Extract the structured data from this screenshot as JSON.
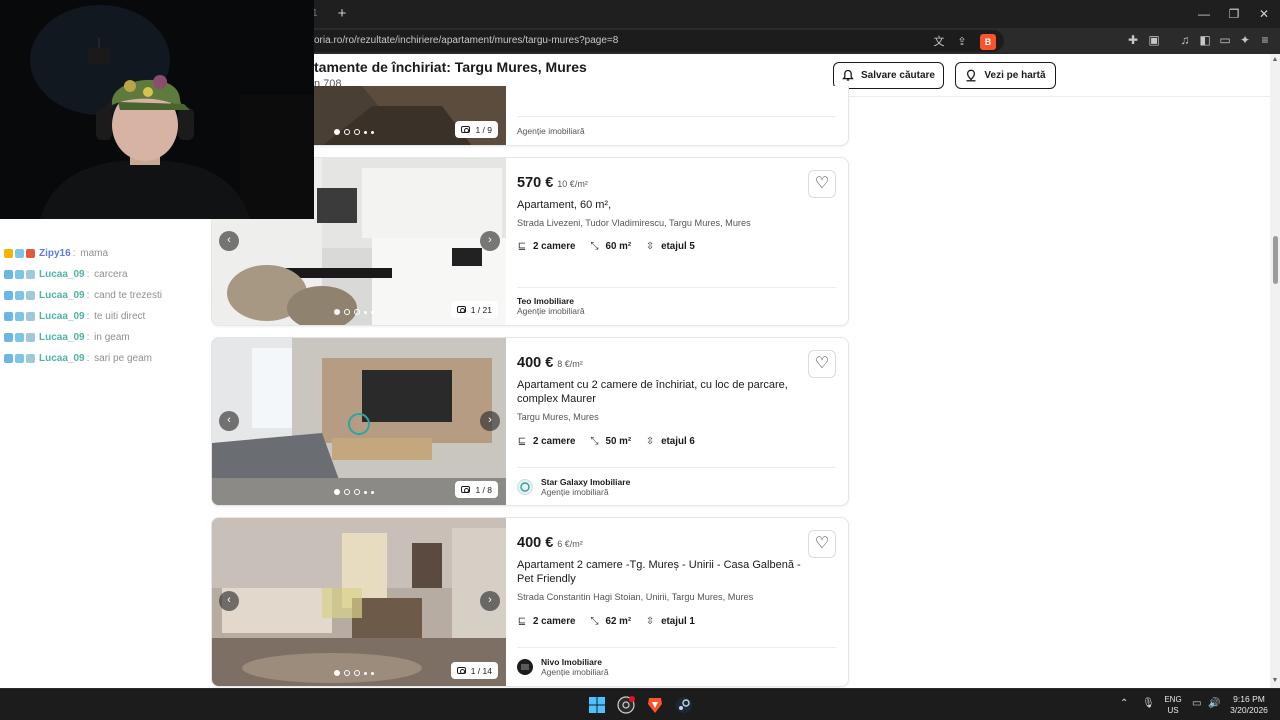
{
  "browser": {
    "url": "oria.ro/ro/rezultate/inchiriere/apartament/mures/targu-mures?page=8",
    "new_tab": "+",
    "tab_fragment": "1",
    "window": {
      "minimize": "—",
      "restore": "❐",
      "close": "✕"
    }
  },
  "page_header": {
    "title": "tamente de închiriat: Targu Mures, Mures",
    "subtitle": "n 708",
    "save_search_label": "Salvare căutare",
    "map_label": "Vezi pe hartă"
  },
  "listings": [
    {
      "partial": true,
      "photo_counter": "1 / 9",
      "agency_type": "Agenție imobiliară"
    },
    {
      "price": "570 €",
      "price_per_m2": "10 €/m²",
      "title": "Apartament, 60 m²,",
      "address": "Strada Livezeni, Tudor Vladimirescu, Targu Mures, Mures",
      "rooms": "2 camere",
      "area": "60 m²",
      "floor": "etajul 5",
      "agency_name": "Teo Imobiliare",
      "agency_type": "Agenție imobiliară",
      "photo_counter": "1 / 21"
    },
    {
      "price": "400 €",
      "price_per_m2": "8 €/m²",
      "title": "Apartament cu 2 camere de închiriat, cu loc de parcare, complex Maurer",
      "address": "Targu Mures, Mures",
      "rooms": "2 camere",
      "area": "50 m²",
      "floor": "etajul 6",
      "agency_name": "Star Galaxy Imobiliare",
      "agency_type": "Agenție imobiliară",
      "photo_counter": "1 / 8"
    },
    {
      "price": "400 €",
      "price_per_m2": "6 €/m²",
      "title": "Apartament 2 camere -Tg. Mureș - Unirii - Casa Galbenă - Pet Friendly",
      "address": "Strada Constantin Hagi Stoian, Unirii, Targu Mures, Mures",
      "rooms": "2 camere",
      "area": "62 m²",
      "floor": "etajul 1",
      "agency_name": "Nivo Imobiliare",
      "agency_type": "Agenție imobiliară",
      "photo_counter": "1 / 14"
    }
  ],
  "chat": [
    {
      "user": "Zipy16",
      "message": "mama",
      "color": "#5a7be0"
    },
    {
      "user": "Lucaa_09",
      "message": "carcera",
      "color": "#4fb3a6"
    },
    {
      "user": "Lucaa_09",
      "message": "cand te trezesti",
      "color": "#4fb3a6"
    },
    {
      "user": "Lucaa_09",
      "message": "te uiti direct",
      "color": "#4fb3a6"
    },
    {
      "user": "Lucaa_09",
      "message": "in geam",
      "color": "#4fb3a6"
    },
    {
      "user": "Lucaa_09",
      "message": "sari pe geam",
      "color": "#4fb3a6"
    }
  ],
  "taskbar": {
    "lang_top": "ENG",
    "lang_bottom": "US",
    "time": "9:16 PM",
    "date": "3/20/2026"
  },
  "colors": {
    "accent": "#1a1a1a",
    "chrome_dark": "#1f1f1f",
    "brave": "#fb542b",
    "chat_user": "#4fb3a6"
  }
}
